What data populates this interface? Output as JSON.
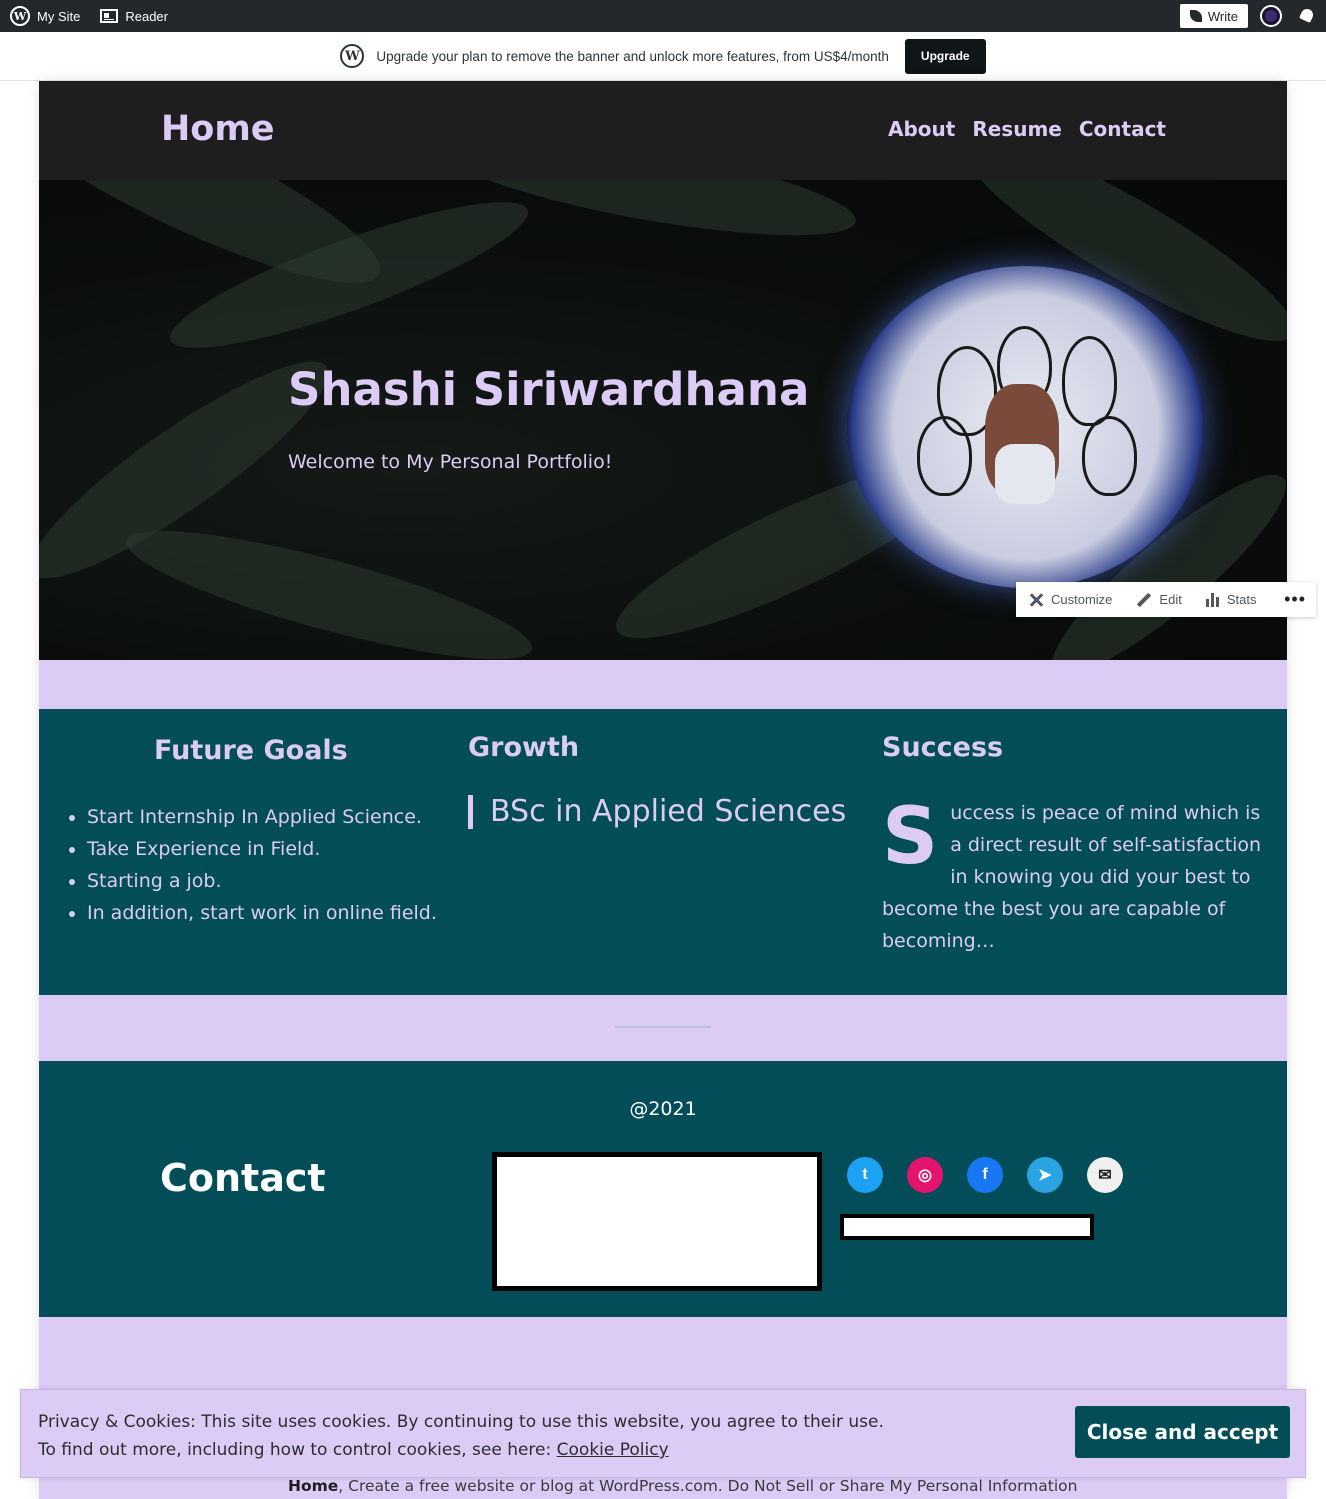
{
  "admin_bar": {
    "my_site": "My Site",
    "reader": "Reader",
    "write": "Write"
  },
  "upgrade_banner": {
    "message": "Upgrade your plan to remove the banner and unlock more features, from US$4/month",
    "button": "Upgrade"
  },
  "header": {
    "site_title": "Home",
    "nav": [
      "About",
      "Resume",
      "Contact"
    ]
  },
  "hero": {
    "title": "Shashi Siriwardhana",
    "subtitle": "Welcome to My Personal Portfolio!"
  },
  "admin_toolbar": {
    "customize": "Customize",
    "edit": "Edit",
    "stats": "Stats",
    "more": "•••"
  },
  "features": {
    "goals_title": "Future Goals",
    "goals": [
      "Start Internship In Applied Science.",
      "Take Experience in Field.",
      "Starting a job.",
      "In addition, start work in online field."
    ],
    "growth_title": "Growth",
    "growth_quote": "BSc in Applied Sciences",
    "success_title": "Success",
    "success_dropcap": "S",
    "success_text": "uccess is peace of mind which is a direct result of self-satisfaction in knowing you did your best to become the best you are capable of becoming…"
  },
  "footer": {
    "copyright": "@2021",
    "contact_title": "Contact",
    "social_icons": [
      "twitter-icon",
      "instagram-icon",
      "facebook-icon",
      "telegram-icon",
      "mail-icon"
    ],
    "social_colors": [
      "#1da1f2",
      "#e4136b",
      "#1877f2",
      "#2aa3e2",
      "#f0f0f0"
    ]
  },
  "bottom": {
    "home": "Home",
    "rest": ", Create a free website or blog at WordPress.com.  Do Not Sell or Share My Personal Information"
  },
  "cookie": {
    "line1": "Privacy & Cookies: This site uses cookies. By continuing to use this website, you agree to their use.",
    "line2": "To find out more, including how to control cookies, see here: ",
    "link": "Cookie Policy",
    "button": "Close and accept"
  }
}
